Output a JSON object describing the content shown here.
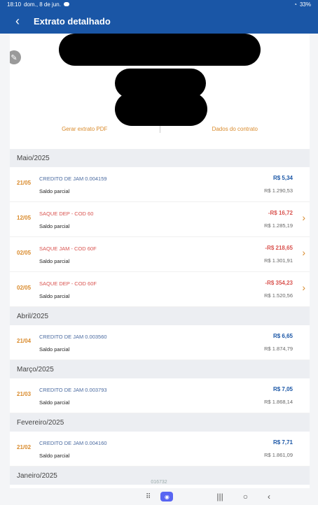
{
  "status": {
    "time": "18:10",
    "date": "dom., 8 de jun.",
    "battery": "33%"
  },
  "app": {
    "title": "Extrato detalhado"
  },
  "header": {
    "link_pdf": "Gerar extrato PDF",
    "link_contract": "Dados do contrato"
  },
  "icons": {
    "back": "chevron-left-icon",
    "edit": "pencil-icon",
    "chevron": "chevron-right-icon"
  },
  "colors": {
    "primary": "#1a56a6",
    "accent": "#d98a2b",
    "debit": "#d9534f"
  },
  "months": [
    {
      "label": "Maio/2025",
      "transactions": [
        {
          "date": "21/05",
          "desc": "CREDITO DE JAM 0.004159",
          "amount": "R$ 5,34",
          "saldo_label": "Saldo parcial",
          "balance": "R$ 1.290,53",
          "type": "credit"
        },
        {
          "date": "12/05",
          "desc": "SAQUE DEP - COD 60",
          "amount": "-R$ 16,72",
          "saldo_label": "Saldo parcial",
          "balance": "R$ 1.285,19",
          "type": "debit"
        },
        {
          "date": "02/05",
          "desc": "SAQUE JAM - COD 60F",
          "amount": "-R$ 218,65",
          "saldo_label": "Saldo parcial",
          "balance": "R$ 1.301,91",
          "type": "debit"
        },
        {
          "date": "02/05",
          "desc": "SAQUE DEP - COD 60F",
          "amount": "-R$ 354,23",
          "saldo_label": "Saldo parcial",
          "balance": "R$ 1.520,56",
          "type": "debit"
        }
      ]
    },
    {
      "label": "Abril/2025",
      "transactions": [
        {
          "date": "21/04",
          "desc": "CREDITO DE JAM 0.003560",
          "amount": "R$ 6,65",
          "saldo_label": "Saldo parcial",
          "balance": "R$ 1.874,79",
          "type": "credit"
        }
      ]
    },
    {
      "label": "Março/2025",
      "transactions": [
        {
          "date": "21/03",
          "desc": "CREDITO DE JAM 0.003793",
          "amount": "R$ 7,05",
          "saldo_label": "Saldo parcial",
          "balance": "R$ 1.868,14",
          "type": "credit"
        }
      ]
    },
    {
      "label": "Fevereiro/2025",
      "transactions": [
        {
          "date": "21/02",
          "desc": "CREDITO DE JAM 0.004160",
          "amount": "R$ 7,71",
          "saldo_label": "Saldo parcial",
          "balance": "R$ 1.861,09",
          "type": "credit"
        }
      ]
    },
    {
      "label": "Janeiro/2025",
      "transactions": []
    }
  ],
  "footer": {
    "hint": "016732"
  }
}
